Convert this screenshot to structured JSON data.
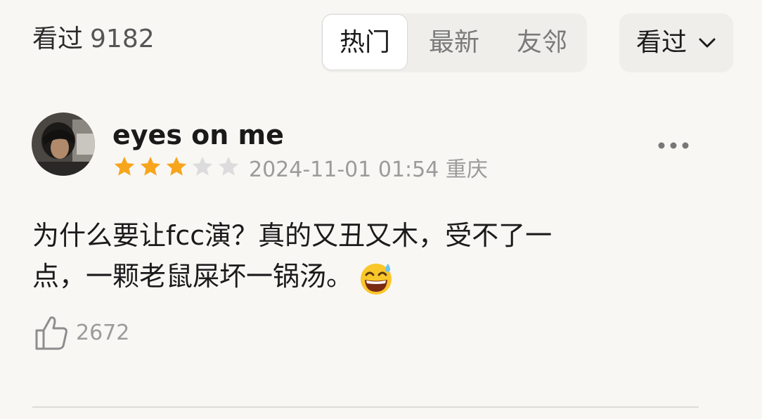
{
  "header": {
    "count_label": "看过",
    "count_value": "9182"
  },
  "tabs": [
    {
      "label": "热门",
      "active": true
    },
    {
      "label": "最新",
      "active": false
    },
    {
      "label": "友邻",
      "active": false
    }
  ],
  "filter": {
    "label": "看过",
    "icon": "chevron-down-icon"
  },
  "review": {
    "username": "eyes on me",
    "rating": 3,
    "rating_max": 5,
    "timestamp": "2024-11-01 01:54",
    "location": "重庆",
    "content_line1": "为什么要让fcc演？真的又丑又木，受不了一",
    "content_line2": "点，一颗老鼠屎坏一锅汤。",
    "emoji": "grinning-sweat-emoji",
    "like_count": "2672"
  },
  "colors": {
    "star_filled": "#f7a51c",
    "star_empty": "#dcdcdc",
    "background": "#f8f7f4"
  }
}
